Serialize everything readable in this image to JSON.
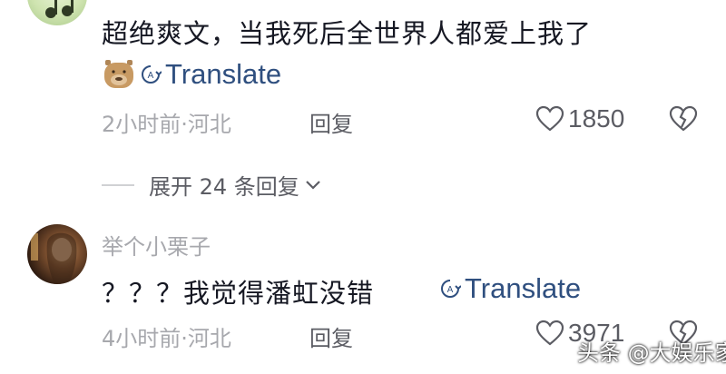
{
  "comments": [
    {
      "text": "超绝爽文，当我死后全世界人都爱上我了",
      "emoji": "capybara-emoji",
      "translate_label": "Translate",
      "time": "2小时前",
      "location": "河北",
      "meta": "2小时前·河北",
      "reply_label": "回复",
      "like_count": "1850"
    },
    {
      "username": "举个小栗子",
      "text": "？？？我觉得潘虹没错",
      "translate_label": "Translate",
      "time": "4小时前",
      "location": "河北",
      "meta": "4小时前·河北",
      "reply_label": "回复",
      "like_count": "3971"
    }
  ],
  "replies_toggle": {
    "label": "展开 24 条回复"
  },
  "watermark": {
    "text": "头条 @大娱乐家"
  },
  "colors": {
    "text": "#161823",
    "meta": "#a7a8ad",
    "action": "#5b5c63",
    "translate": "#2f4f7f"
  }
}
